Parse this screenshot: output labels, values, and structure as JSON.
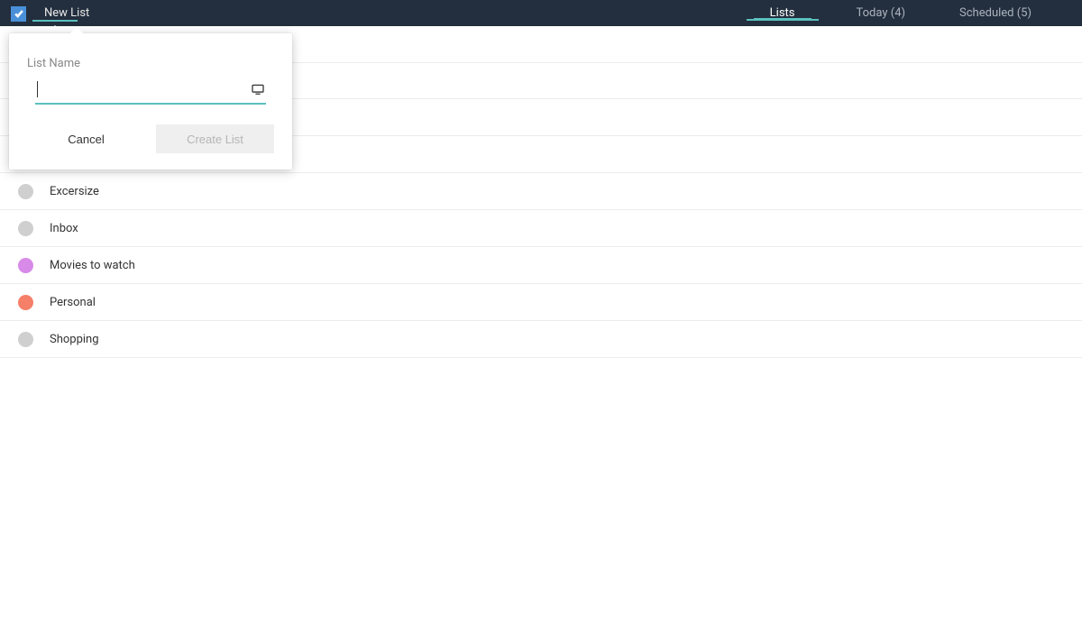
{
  "topbar": {
    "new_list_label": "New List",
    "tabs": {
      "lists": "Lists",
      "today": "Today (4)",
      "scheduled": "Scheduled (5)"
    }
  },
  "popover": {
    "label": "List Name",
    "input_value": "",
    "cancel_label": "Cancel",
    "create_label": "Create List"
  },
  "lists": [
    {
      "label": "",
      "color": "#cfcfcf"
    },
    {
      "label": "",
      "color": "#cfcfcf"
    },
    {
      "label": "",
      "color": "#5cbfa7"
    },
    {
      "label": "Excersize",
      "color": "#cfcfcf"
    },
    {
      "label": "Inbox",
      "color": "#cfcfcf"
    },
    {
      "label": "Movies to watch",
      "color": "#d88ae8"
    },
    {
      "label": "Personal",
      "color": "#f57f68"
    },
    {
      "label": "Shopping",
      "color": "#cfcfcf"
    }
  ]
}
